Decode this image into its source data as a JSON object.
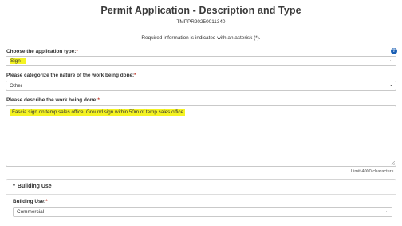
{
  "page": {
    "title": "Permit Application - Description and Type",
    "application_number": "TMPPR20250011340",
    "required_note": "Required information is indicated with an asterisk (*)."
  },
  "application_type": {
    "label": "Choose the application type:",
    "required_mark": "*",
    "value": "Sign",
    "help_icon": "question-circle-icon"
  },
  "work_category": {
    "label": "Please categorize the nature of the work being done:",
    "required_mark": "*",
    "value": "Other"
  },
  "work_description": {
    "label": "Please describe the work being done:",
    "required_mark": "*",
    "value": "Fascia sign on temp sales office.  Ground sign within 50m of temp sales office",
    "limit_text": "Limit 4000 characters."
  },
  "building_use_panel": {
    "header": "Building Use",
    "collapse_icon": "caret-down-icon",
    "label": "Building Use:",
    "required_mark": "*",
    "value": "Commercial"
  },
  "colors": {
    "highlight": "#f4f322",
    "accent": "#1a5fb4",
    "required": "#c0392b"
  }
}
